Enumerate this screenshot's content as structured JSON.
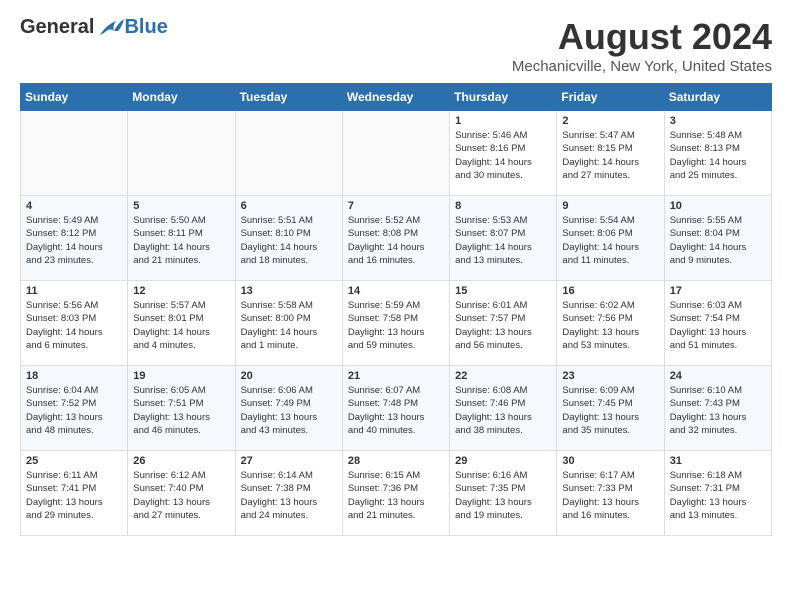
{
  "logo": {
    "general": "General",
    "blue": "Blue"
  },
  "title": "August 2024",
  "location": "Mechanicville, New York, United States",
  "days_of_week": [
    "Sunday",
    "Monday",
    "Tuesday",
    "Wednesday",
    "Thursday",
    "Friday",
    "Saturday"
  ],
  "weeks": [
    [
      {
        "day": "",
        "info": ""
      },
      {
        "day": "",
        "info": ""
      },
      {
        "day": "",
        "info": ""
      },
      {
        "day": "",
        "info": ""
      },
      {
        "day": "1",
        "info": "Sunrise: 5:46 AM\nSunset: 8:16 PM\nDaylight: 14 hours\nand 30 minutes."
      },
      {
        "day": "2",
        "info": "Sunrise: 5:47 AM\nSunset: 8:15 PM\nDaylight: 14 hours\nand 27 minutes."
      },
      {
        "day": "3",
        "info": "Sunrise: 5:48 AM\nSunset: 8:13 PM\nDaylight: 14 hours\nand 25 minutes."
      }
    ],
    [
      {
        "day": "4",
        "info": "Sunrise: 5:49 AM\nSunset: 8:12 PM\nDaylight: 14 hours\nand 23 minutes."
      },
      {
        "day": "5",
        "info": "Sunrise: 5:50 AM\nSunset: 8:11 PM\nDaylight: 14 hours\nand 21 minutes."
      },
      {
        "day": "6",
        "info": "Sunrise: 5:51 AM\nSunset: 8:10 PM\nDaylight: 14 hours\nand 18 minutes."
      },
      {
        "day": "7",
        "info": "Sunrise: 5:52 AM\nSunset: 8:08 PM\nDaylight: 14 hours\nand 16 minutes."
      },
      {
        "day": "8",
        "info": "Sunrise: 5:53 AM\nSunset: 8:07 PM\nDaylight: 14 hours\nand 13 minutes."
      },
      {
        "day": "9",
        "info": "Sunrise: 5:54 AM\nSunset: 8:06 PM\nDaylight: 14 hours\nand 11 minutes."
      },
      {
        "day": "10",
        "info": "Sunrise: 5:55 AM\nSunset: 8:04 PM\nDaylight: 14 hours\nand 9 minutes."
      }
    ],
    [
      {
        "day": "11",
        "info": "Sunrise: 5:56 AM\nSunset: 8:03 PM\nDaylight: 14 hours\nand 6 minutes."
      },
      {
        "day": "12",
        "info": "Sunrise: 5:57 AM\nSunset: 8:01 PM\nDaylight: 14 hours\nand 4 minutes."
      },
      {
        "day": "13",
        "info": "Sunrise: 5:58 AM\nSunset: 8:00 PM\nDaylight: 14 hours\nand 1 minute."
      },
      {
        "day": "14",
        "info": "Sunrise: 5:59 AM\nSunset: 7:58 PM\nDaylight: 13 hours\nand 59 minutes."
      },
      {
        "day": "15",
        "info": "Sunrise: 6:01 AM\nSunset: 7:57 PM\nDaylight: 13 hours\nand 56 minutes."
      },
      {
        "day": "16",
        "info": "Sunrise: 6:02 AM\nSunset: 7:56 PM\nDaylight: 13 hours\nand 53 minutes."
      },
      {
        "day": "17",
        "info": "Sunrise: 6:03 AM\nSunset: 7:54 PM\nDaylight: 13 hours\nand 51 minutes."
      }
    ],
    [
      {
        "day": "18",
        "info": "Sunrise: 6:04 AM\nSunset: 7:52 PM\nDaylight: 13 hours\nand 48 minutes."
      },
      {
        "day": "19",
        "info": "Sunrise: 6:05 AM\nSunset: 7:51 PM\nDaylight: 13 hours\nand 46 minutes."
      },
      {
        "day": "20",
        "info": "Sunrise: 6:06 AM\nSunset: 7:49 PM\nDaylight: 13 hours\nand 43 minutes."
      },
      {
        "day": "21",
        "info": "Sunrise: 6:07 AM\nSunset: 7:48 PM\nDaylight: 13 hours\nand 40 minutes."
      },
      {
        "day": "22",
        "info": "Sunrise: 6:08 AM\nSunset: 7:46 PM\nDaylight: 13 hours\nand 38 minutes."
      },
      {
        "day": "23",
        "info": "Sunrise: 6:09 AM\nSunset: 7:45 PM\nDaylight: 13 hours\nand 35 minutes."
      },
      {
        "day": "24",
        "info": "Sunrise: 6:10 AM\nSunset: 7:43 PM\nDaylight: 13 hours\nand 32 minutes."
      }
    ],
    [
      {
        "day": "25",
        "info": "Sunrise: 6:11 AM\nSunset: 7:41 PM\nDaylight: 13 hours\nand 29 minutes."
      },
      {
        "day": "26",
        "info": "Sunrise: 6:12 AM\nSunset: 7:40 PM\nDaylight: 13 hours\nand 27 minutes."
      },
      {
        "day": "27",
        "info": "Sunrise: 6:14 AM\nSunset: 7:38 PM\nDaylight: 13 hours\nand 24 minutes."
      },
      {
        "day": "28",
        "info": "Sunrise: 6:15 AM\nSunset: 7:36 PM\nDaylight: 13 hours\nand 21 minutes."
      },
      {
        "day": "29",
        "info": "Sunrise: 6:16 AM\nSunset: 7:35 PM\nDaylight: 13 hours\nand 19 minutes."
      },
      {
        "day": "30",
        "info": "Sunrise: 6:17 AM\nSunset: 7:33 PM\nDaylight: 13 hours\nand 16 minutes."
      },
      {
        "day": "31",
        "info": "Sunrise: 6:18 AM\nSunset: 7:31 PM\nDaylight: 13 hours\nand 13 minutes."
      }
    ]
  ]
}
